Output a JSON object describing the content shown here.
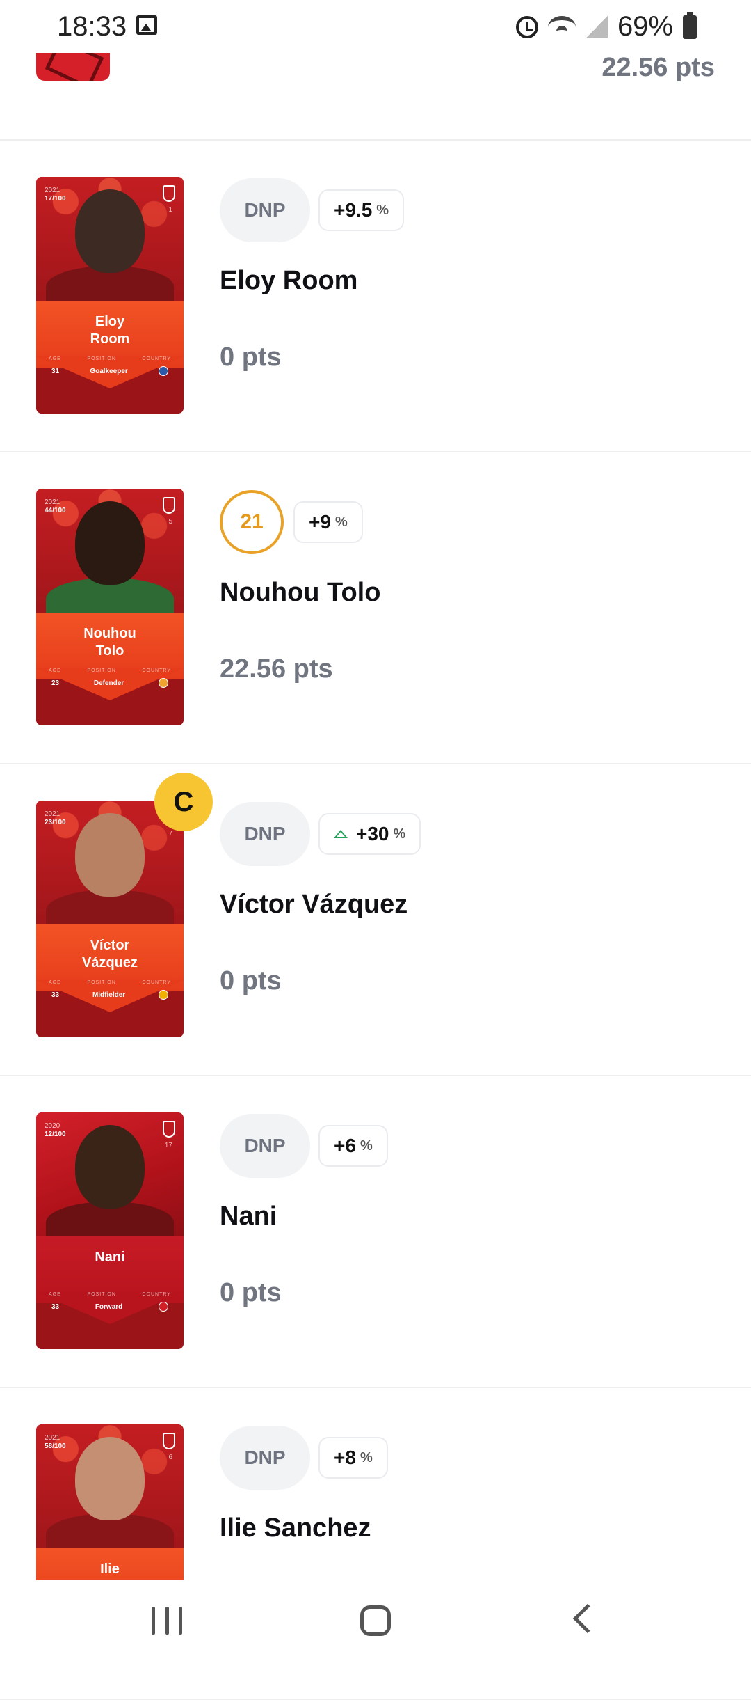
{
  "status_bar": {
    "time": "18:33",
    "battery": "69%",
    "icons": [
      "gallery-icon",
      "alarm-icon",
      "wifi-icon",
      "signal-icon",
      "battery-icon"
    ]
  },
  "top_row": {
    "points": "22.56 pts"
  },
  "players": [
    {
      "card": {
        "year": "2021",
        "serial": "17/100",
        "number": "1",
        "name": "Eloy\nRoom",
        "age": "31",
        "position": "Goalkeeper",
        "labels": [
          "AGE",
          "POSITION",
          "COUNTRY"
        ]
      },
      "score_type": "pill",
      "score": "DNP",
      "bonus": "+9.5",
      "bonus_trend": "none",
      "name": "Eloy Room",
      "points": "0 pts",
      "captain": false
    },
    {
      "card": {
        "year": "2021",
        "serial": "44/100",
        "number": "5",
        "name": "Nouhou\nTolo",
        "age": "23",
        "position": "Defender",
        "labels": [
          "AGE",
          "POSITION",
          "COUNTRY"
        ]
      },
      "score_type": "circle",
      "score": "21",
      "bonus": "+9",
      "bonus_trend": "none",
      "name": "Nouhou Tolo",
      "points": "22.56 pts",
      "captain": false
    },
    {
      "card": {
        "year": "2021",
        "serial": "23/100",
        "number": "7",
        "name": "Víctor\nVázquez",
        "age": "33",
        "position": "Midfielder",
        "labels": [
          "AGE",
          "POSITION",
          "COUNTRY"
        ]
      },
      "score_type": "pill",
      "score": "DNP",
      "bonus": "+30",
      "bonus_trend": "up",
      "name": "Víctor Vázquez",
      "points": "0 pts",
      "captain": true,
      "captain_label": "C"
    },
    {
      "card": {
        "year": "2020",
        "serial": "12/100",
        "number": "17",
        "name": "Nani",
        "age": "33",
        "position": "Forward",
        "labels": [
          "AGE",
          "POSITION",
          "COUNTRY"
        ]
      },
      "score_type": "pill",
      "score": "DNP",
      "bonus": "+6",
      "bonus_trend": "none",
      "name": "Nani",
      "points": "0 pts",
      "captain": false
    },
    {
      "card": {
        "year": "2021",
        "serial": "58/100",
        "number": "6",
        "name": "Ilie\nSanchez",
        "age": "",
        "position": "",
        "labels": [
          "",
          "",
          ""
        ]
      },
      "score_type": "pill",
      "score": "DNP",
      "bonus": "+8",
      "bonus_trend": "none",
      "name": "Ilie Sanchez",
      "points": "",
      "captain": false
    }
  ],
  "colors": {
    "card_red": "#c81c22",
    "card_band": "#e63c1c",
    "score_circle": "#e8a227",
    "captain": "#f7c531",
    "trend_up": "#22a35a"
  },
  "nav_bar": {
    "icons": [
      "recent-apps-icon",
      "home-icon",
      "back-icon"
    ]
  }
}
